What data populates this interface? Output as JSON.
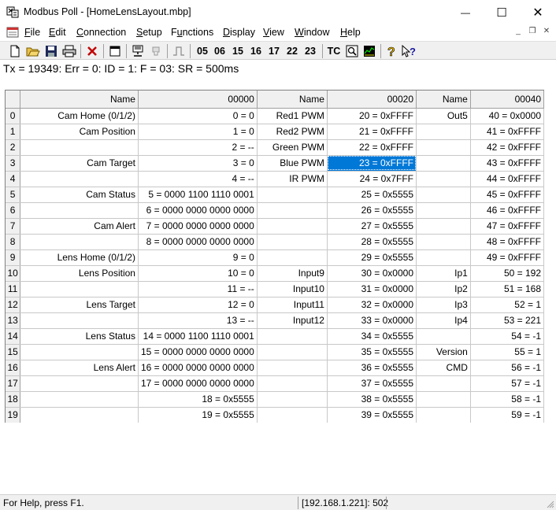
{
  "window": {
    "title": "Modbus Poll - [HomeLensLayout.mbp]",
    "minimize_glyph": "—",
    "maximize_glyph": "☐",
    "close_glyph": "✕"
  },
  "menu": {
    "items": [
      {
        "label": "File",
        "accel": "F",
        "rest": "ile"
      },
      {
        "label": "Edit",
        "accel": "E",
        "rest": "dit"
      },
      {
        "label": "Connection",
        "accel": "C",
        "rest": "onnection"
      },
      {
        "label": "Setup",
        "accel": "S",
        "rest": "etup"
      },
      {
        "label": "Functions",
        "accel": "u",
        "pre": "F",
        "rest": "nctions"
      },
      {
        "label": "Display",
        "accel": "D",
        "rest": "isplay"
      },
      {
        "label": "View",
        "accel": "V",
        "rest": "iew"
      },
      {
        "label": "Window",
        "accel": "W",
        "rest": "indow"
      },
      {
        "label": "Help",
        "accel": "H",
        "rest": "elp"
      }
    ],
    "mdi_min": "_",
    "mdi_restore": "❐",
    "mdi_close": "✕"
  },
  "toolbar": {
    "icons": [
      "new-document-icon",
      "open-folder-icon",
      "save-icon",
      "print-icon",
      "delete-icon",
      "window-icon",
      "connect-icon",
      "disconnect-icon",
      "pulse-icon",
      "traffic-icon",
      "chart-icon",
      "help-icon",
      "context-help-icon"
    ],
    "function_codes": [
      "05",
      "06",
      "15",
      "16",
      "17",
      "22",
      "23"
    ],
    "tc_label": "TC"
  },
  "poll_status": "Tx = 19349: Err = 0: ID = 1: F = 03: SR = 500ms",
  "grid": {
    "headers": [
      "",
      "Name",
      "00000",
      "Name",
      "00020",
      "Name",
      "00040"
    ],
    "selected": {
      "row": 3,
      "col": 4
    },
    "rows": [
      [
        "0",
        "Cam Home (0/1/2)",
        "0 = 0",
        "Red1 PWM",
        "20 = 0xFFFF",
        "Out5",
        "40 = 0x0000"
      ],
      [
        "1",
        "Cam Position",
        "1 = 0",
        "Red2 PWM",
        "21 = 0xFFFF",
        "",
        "41 = 0xFFFF"
      ],
      [
        "2",
        "",
        "2 = --",
        "Green PWM",
        "22 = 0xFFFF",
        "",
        "42 = 0xFFFF"
      ],
      [
        "3",
        "Cam Target",
        "3 = 0",
        "Blue PWM",
        "23 = 0xFFFF",
        "",
        "43 = 0xFFFF"
      ],
      [
        "4",
        "",
        "4 = --",
        "IR PWM",
        "24 = 0x7FFF",
        "",
        "44 = 0xFFFF"
      ],
      [
        "5",
        "Cam Status",
        "5 = 0000 1100 1110 0001",
        "",
        "25 = 0x5555",
        "",
        "45 = 0xFFFF"
      ],
      [
        "6",
        "",
        "6 = 0000 0000 0000 0000",
        "",
        "26 = 0x5555",
        "",
        "46 = 0xFFFF"
      ],
      [
        "7",
        "Cam Alert",
        "7 = 0000 0000 0000 0000",
        "",
        "27 = 0x5555",
        "",
        "47 = 0xFFFF"
      ],
      [
        "8",
        "",
        "8 = 0000 0000 0000 0000",
        "",
        "28 = 0x5555",
        "",
        "48 = 0xFFFF"
      ],
      [
        "9",
        "Lens Home (0/1/2)",
        "9 = 0",
        "",
        "29 = 0x5555",
        "",
        "49 = 0xFFFF"
      ],
      [
        "10",
        "Lens Position",
        "10 = 0",
        "Input9",
        "30 = 0x0000",
        "Ip1",
        "50 = 192"
      ],
      [
        "11",
        "",
        "11 = --",
        "Input10",
        "31 = 0x0000",
        "Ip2",
        "51 = 168"
      ],
      [
        "12",
        "Lens Target",
        "12 = 0",
        "Input11",
        "32 = 0x0000",
        "Ip3",
        "52 = 1"
      ],
      [
        "13",
        "",
        "13 = --",
        "Input12",
        "33 = 0x0000",
        "Ip4",
        "53 = 221"
      ],
      [
        "14",
        "Lens Status",
        "14 = 0000 1100 1110 0001",
        "",
        "34 = 0x5555",
        "",
        "54 = -1"
      ],
      [
        "15",
        "",
        "15 = 0000 0000 0000 0000",
        "",
        "35 = 0x5555",
        "Version",
        "55 = 1"
      ],
      [
        "16",
        "Lens Alert",
        "16 = 0000 0000 0000 0000",
        "",
        "36 = 0x5555",
        "CMD",
        "56 = -1"
      ],
      [
        "17",
        "",
        "17 = 0000 0000 0000 0000",
        "",
        "37 = 0x5555",
        "",
        "57 = -1"
      ],
      [
        "18",
        "",
        "18 = 0x5555",
        "",
        "38 = 0x5555",
        "",
        "58 = -1"
      ],
      [
        "19",
        "",
        "19 = 0x5555",
        "",
        "39 = 0x5555",
        "",
        "59 = -1"
      ]
    ]
  },
  "statusbar": {
    "help": "For Help, press F1.",
    "connection": "[192.168.1.221]: 502"
  },
  "colors": {
    "selection": "#0078d7",
    "header_bg": "#f0f0f0"
  }
}
